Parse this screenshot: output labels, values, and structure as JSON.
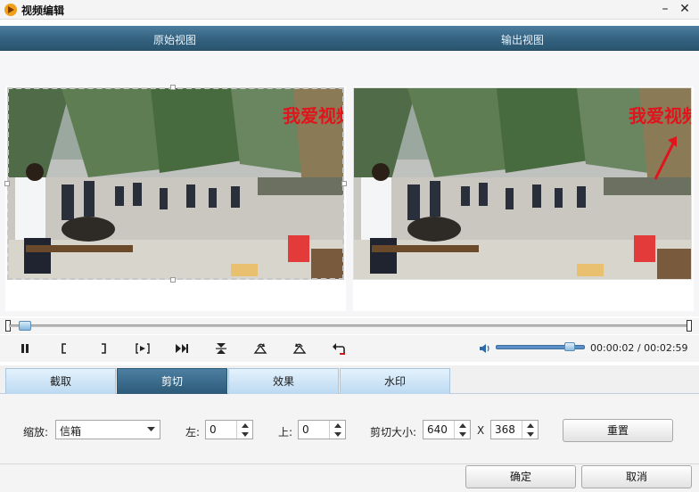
{
  "window": {
    "title": "视频编辑",
    "minimize_label": "–",
    "close_label": "✕"
  },
  "views": {
    "original_label": "原始视图",
    "output_label": "输出视图"
  },
  "video": {
    "watermark_text": "我爱视频"
  },
  "player": {
    "time_current": "00:00:02",
    "time_separator": "/",
    "time_total": "00:02:59",
    "progress_fraction": 0.01,
    "volume_fraction": 0.88
  },
  "tabs": [
    {
      "label": "截取"
    },
    {
      "label": "剪切"
    },
    {
      "label": "效果"
    },
    {
      "label": "水印"
    }
  ],
  "active_tab": "剪切",
  "crop": {
    "zoom_label": "缩放:",
    "zoom_value": "信箱",
    "left_label": "左:",
    "left_value": "0",
    "top_label": "上:",
    "top_value": "0",
    "size_label": "剪切大小:",
    "width_value": "640",
    "x_label": "X",
    "height_value": "368",
    "reset_label": "重置"
  },
  "footer": {
    "ok_label": "确定",
    "cancel_label": "取消"
  },
  "colors": {
    "header_blue": "#33627f",
    "tab_active": "#2c5a78",
    "tab_inactive": "#bcd9f1",
    "watermark_red": "#e0141c"
  }
}
